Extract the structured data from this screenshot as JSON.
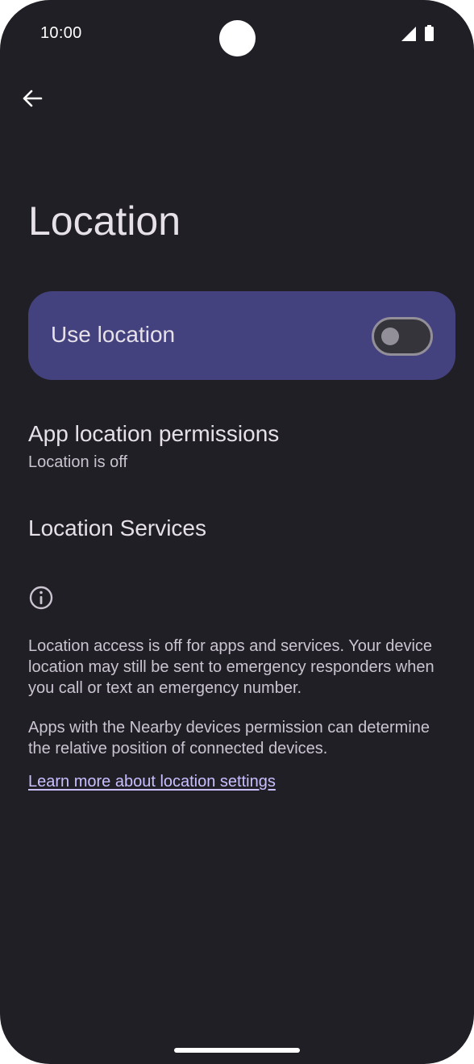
{
  "status_bar": {
    "time": "10:00",
    "signal_icon": "cellular-signal-icon",
    "battery_icon": "battery-full-icon"
  },
  "header": {
    "back_icon": "arrow-back-icon",
    "title": "Location"
  },
  "use_location": {
    "label": "Use location",
    "enabled": false
  },
  "items": [
    {
      "title": "App location permissions",
      "subtitle": "Location is off"
    },
    {
      "title": "Location Services"
    }
  ],
  "footer": {
    "info_icon": "info-icon",
    "paragraph_1": "Location access is off for apps and services. Your device location may still be sent to emergency responders when you call or text an emergency number.",
    "paragraph_2": "Apps with the Nearby devices permission can determine the relative position of connected devices.",
    "learn_more_link": "Learn more about location settings"
  },
  "colors": {
    "background": "#211f26",
    "card": "#44427e",
    "link": "#c9bfff",
    "text_primary": "#e6e1e9",
    "text_secondary": "#cac4d0"
  }
}
